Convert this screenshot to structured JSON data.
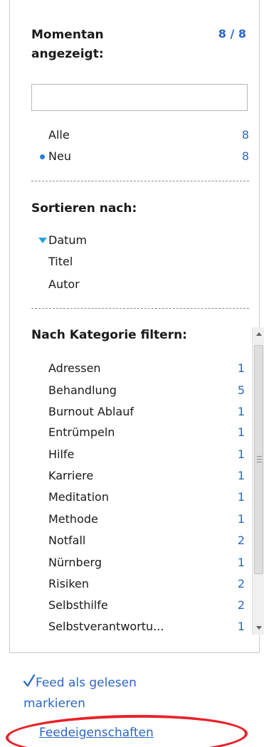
{
  "header": {
    "title": "Momentan angezeigt:",
    "count": "8 / 8"
  },
  "search": {
    "value": "",
    "placeholder": ""
  },
  "filters": [
    {
      "label": "Alle",
      "count": "8"
    },
    {
      "label": "Neu",
      "count": "8"
    }
  ],
  "sort": {
    "title": "Sortieren nach:",
    "options": [
      {
        "label": "Datum",
        "selected": true
      },
      {
        "label": "Titel"
      },
      {
        "label": "Autor"
      }
    ]
  },
  "categories": {
    "title": "Nach Kategorie filtern:",
    "items": [
      {
        "label": "Adressen",
        "count": "1"
      },
      {
        "label": "Behandlung",
        "count": "5"
      },
      {
        "label": "Burnout Ablauf",
        "count": "1"
      },
      {
        "label": "Entrümpeln",
        "count": "1"
      },
      {
        "label": "Hilfe",
        "count": "1"
      },
      {
        "label": "Karriere",
        "count": "1"
      },
      {
        "label": "Meditation",
        "count": "1"
      },
      {
        "label": "Methode",
        "count": "1"
      },
      {
        "label": "Notfall",
        "count": "2"
      },
      {
        "label": "Nürnberg",
        "count": "1"
      },
      {
        "label": "Risiken",
        "count": "2"
      },
      {
        "label": "Selbsthilfe",
        "count": "2"
      },
      {
        "label": "Selbstverantwortu...",
        "count": "1"
      }
    ]
  },
  "links": {
    "mark_read_line1": "Feed als gelesen",
    "mark_read_line2": "markieren",
    "properties": "Feedeigenschaften"
  },
  "colors": {
    "link": "#2a66c6",
    "highlight": "#e8222a",
    "bullet": "#2a7fd6"
  },
  "icons": {
    "mark_read": "checkmark-icon",
    "selected_sort": "triangle-down-icon",
    "new_bullet": "dot-icon"
  }
}
